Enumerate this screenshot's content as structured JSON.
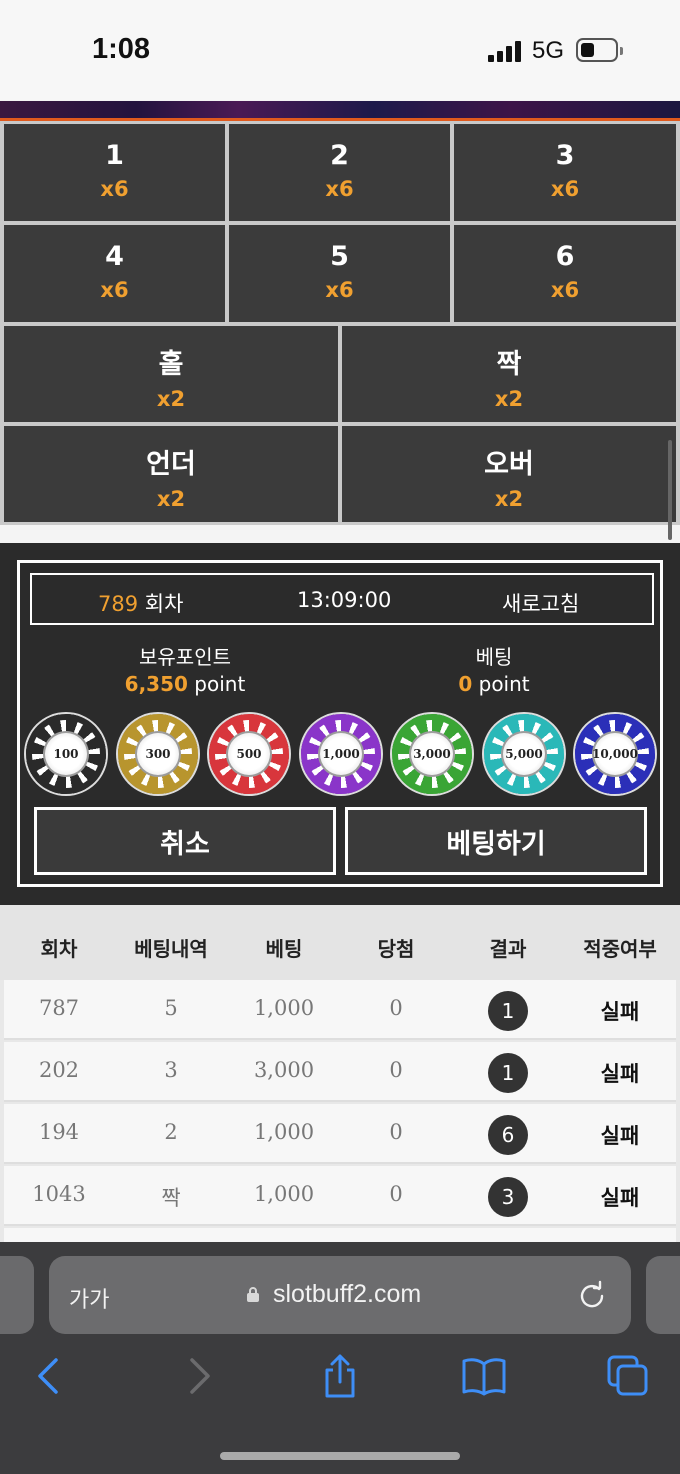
{
  "status_bar": {
    "time": "1:08",
    "network": "5G"
  },
  "bet_grid": [
    {
      "label": "1",
      "odds": "x6"
    },
    {
      "label": "2",
      "odds": "x6"
    },
    {
      "label": "3",
      "odds": "x6"
    },
    {
      "label": "4",
      "odds": "x6"
    },
    {
      "label": "5",
      "odds": "x6"
    },
    {
      "label": "6",
      "odds": "x6"
    },
    {
      "label": "홀",
      "odds": "x2"
    },
    {
      "label": "짝",
      "odds": "x2"
    },
    {
      "label": "언더",
      "odds": "x2"
    },
    {
      "label": "오버",
      "odds": "x2"
    }
  ],
  "panel": {
    "round_number": "789",
    "round_label": "회차",
    "clock": "13:09:00",
    "refresh_label": "새로고침",
    "points_label": "보유포인트",
    "points_value": "6,350",
    "points_unit": "point",
    "bet_label": "베팅",
    "bet_value": "0",
    "bet_unit": "point",
    "chips": [
      {
        "label": "100",
        "color": "#2a2a2a"
      },
      {
        "label": "300",
        "color": "#b8952e"
      },
      {
        "label": "500",
        "color": "#d8363c"
      },
      {
        "label": "1,000",
        "color": "#8a35c9"
      },
      {
        "label": "3,000",
        "color": "#3aa535"
      },
      {
        "label": "5,000",
        "color": "#2ab8b8"
      },
      {
        "label": "10,000",
        "color": "#2b2fb8"
      }
    ],
    "cancel_label": "취소",
    "bet_button_label": "베팅하기"
  },
  "history": {
    "headers": [
      "회차",
      "베팅내역",
      "베팅",
      "당첨",
      "결과",
      "적중여부"
    ],
    "rows": [
      {
        "round": "787",
        "choice": "5",
        "bet": "1,000",
        "win": "0",
        "result": "1",
        "status": "실패"
      },
      {
        "round": "202",
        "choice": "3",
        "bet": "3,000",
        "win": "0",
        "result": "1",
        "status": "실패"
      },
      {
        "round": "194",
        "choice": "2",
        "bet": "1,000",
        "win": "0",
        "result": "6",
        "status": "실패"
      },
      {
        "round": "1043",
        "choice": "짝",
        "bet": "1,000",
        "win": "0",
        "result": "3",
        "status": "실패"
      }
    ]
  },
  "browser": {
    "text_size_label": "가가",
    "url": "slotbuff2.com"
  },
  "colors": {
    "accent": "#f0a030",
    "cell_bg": "#3b3b3b",
    "panel_bg": "#2b2b2b"
  }
}
